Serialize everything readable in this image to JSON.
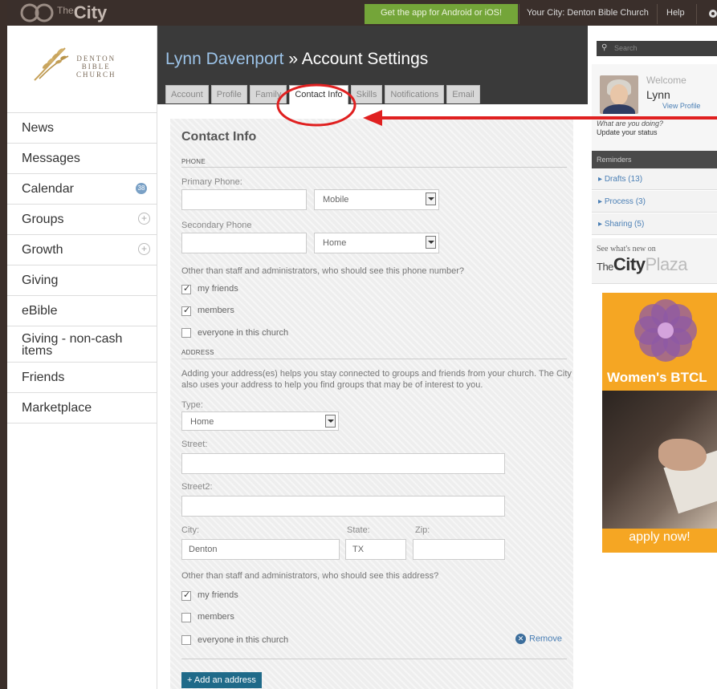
{
  "topbar": {
    "logo_the": "The",
    "logo_city": "City",
    "app_link": "Get the app for Android or iOS!",
    "your_city": "Your City: Denton Bible Church",
    "help": "Help"
  },
  "church": {
    "line1": "DENTON",
    "line2": "BIBLE",
    "line3": "CHURCH"
  },
  "nav": {
    "news": "News",
    "messages": "Messages",
    "calendar": "Calendar",
    "calendar_badge": "38",
    "groups": "Groups",
    "growth": "Growth",
    "giving": "Giving",
    "ebible": "eBible",
    "giving_noncash": "Giving - non-cash items",
    "friends": "Friends",
    "marketplace": "Marketplace"
  },
  "header": {
    "name": "Lynn Davenport",
    "sep": " » ",
    "page": "Account Settings"
  },
  "tabs": [
    "Account",
    "Profile",
    "Family",
    "Contact Info",
    "Skills",
    "Notifications",
    "Email"
  ],
  "form": {
    "title": "Contact Info",
    "phone_section": "PHONE",
    "primary_phone_label": "Primary Phone:",
    "primary_type": "Mobile",
    "secondary_phone_label": "Secondary Phone",
    "secondary_type": "Home",
    "phone_visibility_q": "Other than staff and administrators, who should see this phone number?",
    "phone_opt_friends": "my friends",
    "phone_opt_members": "members",
    "phone_opt_everyone": "everyone in this church",
    "address_section": "ADDRESS",
    "address_info": "Adding your address(es) helps you stay connected to groups and friends from your church. The City also uses your address to help you find groups that may be of interest to you.",
    "type_label": "Type:",
    "type_value": "Home",
    "street_label": "Street:",
    "street2_label": "Street2:",
    "city_label": "City:",
    "city_value": "Denton",
    "state_label": "State:",
    "state_value": "TX",
    "zip_label": "Zip:",
    "addr_visibility_q": "Other than staff and administrators, who should see this address?",
    "addr_opt_friends": "my friends",
    "addr_opt_members": "members",
    "addr_opt_everyone": "everyone in this church",
    "remove": "Remove",
    "add_address": "+ Add an address"
  },
  "right": {
    "search_placeholder": "Search",
    "welcome": "Welcome",
    "user_first": "Lynn",
    "view_profile": "View Profile",
    "doing": "What are you doing?",
    "update_status": "Update your status",
    "reminders": "Reminders",
    "drafts": "Drafts (13)",
    "process": "Process (3)",
    "sharing": "Sharing (5)",
    "plaza_small": "See what's new on",
    "plaza_the": "The",
    "plaza_city": "City",
    "plaza_word": "Plaza",
    "ad_title": "Women's BTCL",
    "ad_apply": "apply now!"
  },
  "colors": {
    "accent_link": "#4a7fb5",
    "app_green": "#74a539",
    "annotation_red": "#e02020",
    "ad_orange": "#f5a623"
  }
}
